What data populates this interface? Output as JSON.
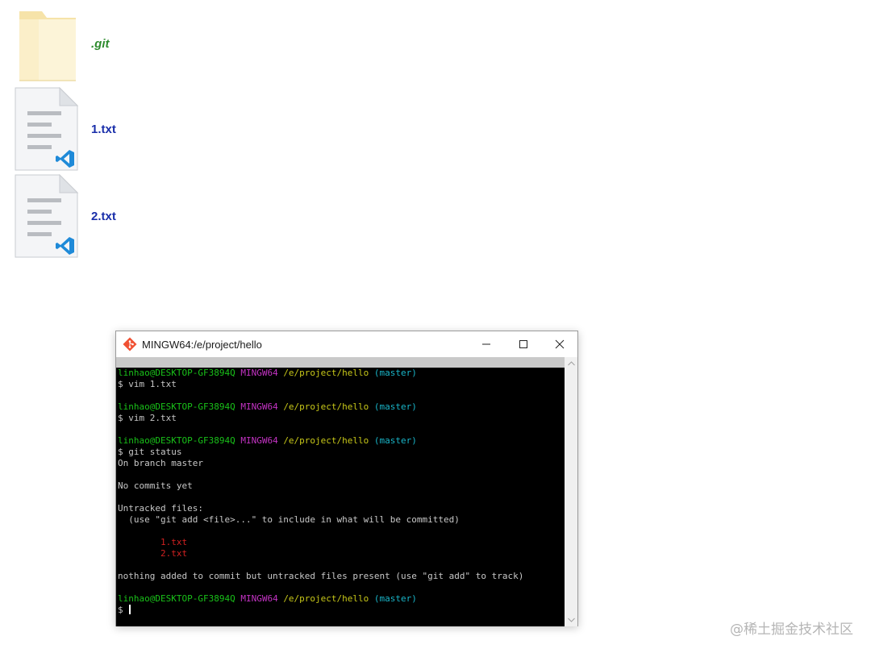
{
  "desktop": {
    "files": [
      {
        "name": ".git",
        "type": "folder",
        "icon": "folder-icon"
      },
      {
        "name": "1.txt",
        "type": "text",
        "icon": "vscode-file-icon"
      },
      {
        "name": "2.txt",
        "type": "text",
        "icon": "vscode-file-icon"
      }
    ]
  },
  "window": {
    "title": "MINGW64:/e/project/hello",
    "app_icon": "git-bash-icon",
    "controls": {
      "minimize": "minimize-icon",
      "maximize": "maximize-icon",
      "close": "close-icon"
    }
  },
  "terminal": {
    "prompt": {
      "user_host": "linhao@DESKTOP-GF3894Q",
      "system": "MINGW64",
      "path": "/e/project/hello",
      "branch": "(master)"
    },
    "commands": [
      "$ vim 1.txt",
      "$ vim 2.txt",
      "$ git status"
    ],
    "output": {
      "branch_line": "On branch master",
      "no_commits": "No commits yet",
      "untracked_header": "Untracked files:",
      "untracked_hint": "  (use \"git add <file>...\" to include in what will be committed)",
      "untracked_files": [
        "        1.txt",
        "        2.txt"
      ],
      "summary": "nothing added to commit but untracked files present (use \"git add\" to track)"
    },
    "final_prompt": "$ "
  },
  "colors": {
    "user_host": "#19c119",
    "system": "#c433c4",
    "path": "#c8c819",
    "branch": "#19b5c8",
    "untracked": "#d22121",
    "text": "#c8c8c8",
    "background": "#000000"
  },
  "watermark": "@稀土掘金技术社区"
}
